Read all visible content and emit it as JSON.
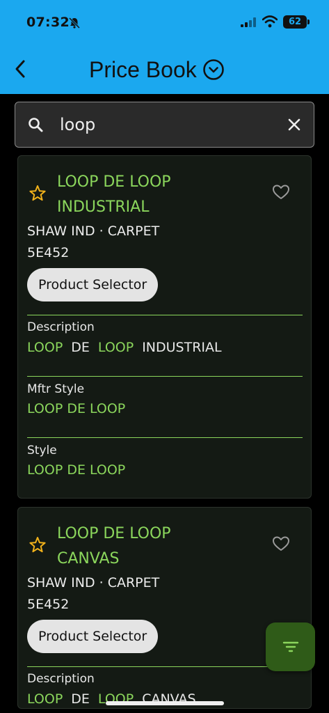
{
  "status_bar": {
    "time": "07:32",
    "battery": "62"
  },
  "header": {
    "title": "Price Book"
  },
  "search": {
    "value": "loop"
  },
  "results": [
    {
      "title_line1": "LOOP DE LOOP",
      "title_line2": "INDUSTRIAL",
      "brand_category": "SHAW IND · CARPET",
      "code": "5E452",
      "selector_label": "Product Selector",
      "description_label": "Description",
      "description_words": [
        "LOOP",
        "DE",
        "LOOP",
        "INDUSTRIAL"
      ],
      "mftr_style_label": "Mftr Style",
      "mftr_style": "LOOP DE LOOP",
      "style_label": "Style",
      "style": "LOOP DE LOOP"
    },
    {
      "title_line1": "LOOP DE LOOP",
      "title_line2": "CANVAS",
      "brand_category": "SHAW IND · CARPET",
      "code": "5E452",
      "selector_label": "Product Selector",
      "description_label": "Description",
      "description_words": [
        "LOOP",
        "DE",
        "LOOP",
        "CANVAS"
      ]
    }
  ],
  "colors": {
    "header_bg": "#1ba8ef",
    "accent_green": "#8bd65c",
    "card_bg": "#141a14",
    "fab_bg": "#2f5b18",
    "star": "#f2b21b"
  }
}
